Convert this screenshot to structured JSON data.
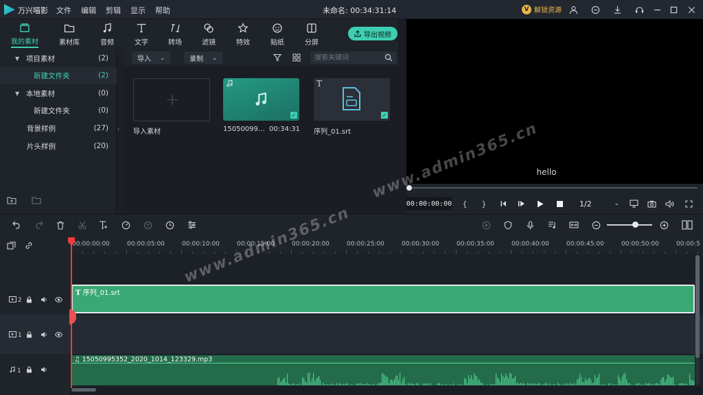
{
  "app": {
    "name": "万兴喵影",
    "title": "未命名: 00:34:31:14"
  },
  "menu": [
    "文件",
    "编辑",
    "剪辑",
    "显示",
    "帮助"
  ],
  "unlock": {
    "badge": "V",
    "label": "解锁资源"
  },
  "tabs": [
    {
      "label": "我的素材",
      "icon": "folder-media-icon",
      "active": true
    },
    {
      "label": "素材库",
      "icon": "folder-icon"
    },
    {
      "label": "音频",
      "icon": "music-note-icon"
    },
    {
      "label": "文字",
      "icon": "text-icon"
    },
    {
      "label": "转场",
      "icon": "transition-icon"
    },
    {
      "label": "滤镜",
      "icon": "filter-icon"
    },
    {
      "label": "特效",
      "icon": "sparkle-icon"
    },
    {
      "label": "贴纸",
      "icon": "sticker-icon"
    },
    {
      "label": "分屏",
      "icon": "split-screen-icon"
    }
  ],
  "export_label": "导出视频",
  "tree": [
    {
      "label": "项目素材",
      "count": "(2)",
      "expanded": true
    },
    {
      "label": "新建文件夹",
      "count": "(2)",
      "selected": true
    },
    {
      "label": "本地素材",
      "count": "(0)",
      "expanded": true
    },
    {
      "label": "新建文件夹",
      "count": "(0)"
    },
    {
      "label": "背景样例",
      "count": "(27)"
    },
    {
      "label": "片头样例",
      "count": "(20)"
    }
  ],
  "mediabar": {
    "import": "导入",
    "record": "录制",
    "search_placeholder": "搜索关键词"
  },
  "media": {
    "import_label": "导入素材",
    "audio_name": "15050099…",
    "audio_duration": "00:34:31",
    "srt_name": "序列_01.srt"
  },
  "preview": {
    "text": "hello",
    "timecode": "00:00:00:00",
    "ratio": "1/2"
  },
  "ruler": [
    "00:00:00:00",
    "00:00:05:00",
    "00:00:10:00",
    "00:00:15:00",
    "00:00:20:00",
    "00:00:25:00",
    "00:00:30:00",
    "00:00:35:00",
    "00:00:40:00",
    "00:00:45:00",
    "00:00:50:00",
    "00:00:5"
  ],
  "tracks": {
    "t2_label": "2",
    "t1_label": "1",
    "a1_label": "1",
    "srt_clip": "序列_01.srt",
    "audio_clip": "15050995352_2020_1014_123329.mp3"
  },
  "watermark": [
    "www.admin365.cn",
    "www.admin365.cn"
  ],
  "colors": {
    "accent": "#3ecfb2",
    "clip_green": "#3aa874",
    "audio_green": "#236b4a",
    "playhead": "#ef3b3b"
  }
}
